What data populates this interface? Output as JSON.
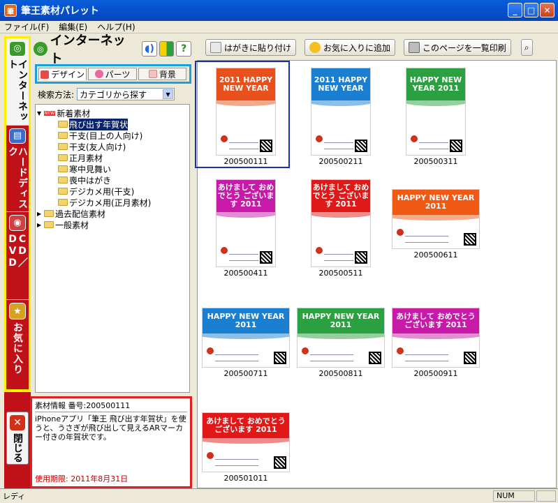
{
  "window": {
    "title": "筆王素材パレット",
    "app_icon": "筆"
  },
  "menu": [
    {
      "label": "ファイル(F)"
    },
    {
      "label": "編集(E)"
    },
    {
      "label": "ヘルプ(H)"
    }
  ],
  "side_tabs": [
    {
      "label": "インターネット",
      "icon": "globe-icon",
      "active": true
    },
    {
      "label": "ハードディスク",
      "icon": "harddisk-icon"
    },
    {
      "label": "CD／DVD",
      "icon": "disc-icon"
    },
    {
      "label": "お気に入り",
      "icon": "star-icon"
    }
  ],
  "close_tab": {
    "label": "閉じる",
    "icon": "close-icon"
  },
  "left_panel": {
    "title": "インターネット",
    "icons": [
      "speaker-icon",
      "beginner-mark-icon",
      "help-icon"
    ],
    "help_glyph": "?"
  },
  "subtabs": [
    {
      "label": "デザイン"
    },
    {
      "label": "パーツ"
    },
    {
      "label": "背景"
    }
  ],
  "search": {
    "label": "検索方法:",
    "value": "カテゴリから探す"
  },
  "tree": [
    {
      "label": "新着素材",
      "level": 0,
      "expanded": true,
      "badge": "NEW"
    },
    {
      "label": "飛び出す年賀状",
      "level": 1,
      "selected": true
    },
    {
      "label": "干支(目上の人向け)",
      "level": 1
    },
    {
      "label": "干支(友人向け)",
      "level": 1
    },
    {
      "label": "正月素材",
      "level": 1
    },
    {
      "label": "寒中見舞い",
      "level": 1
    },
    {
      "label": "喪中はがき",
      "level": 1
    },
    {
      "label": "デジカメ用(干支)",
      "level": 1
    },
    {
      "label": "デジカメ用(正月素材)",
      "level": 1
    },
    {
      "label": "過去配信素材",
      "level": 0,
      "expanded": false
    },
    {
      "label": "一般素材",
      "level": 0,
      "expanded": false
    }
  ],
  "info": {
    "header": "素材情報 番号:200500111",
    "description": "iPhoneアプリ「筆王 飛び出す年賀状」を使うと、うさぎが飛び出して見えるARマーカー付きの年賀状です。",
    "expiry": "使用期限: 2011年8月31日"
  },
  "toolbar": [
    {
      "label": "はがきに貼り付け",
      "icon": "paste-card-icon"
    },
    {
      "label": "お気に入りに追加",
      "icon": "add-favorite-icon"
    },
    {
      "label": "このページを一覧印刷",
      "icon": "print-icon"
    }
  ],
  "thumbnails": [
    {
      "id": "200500111",
      "text": "2011 HAPPY NEW YEAR",
      "color": "#e8501c",
      "orientation": "portrait",
      "selected": true
    },
    {
      "id": "200500211",
      "text": "2011 HAPPY NEW YEAR",
      "color": "#1a7fd0",
      "orientation": "portrait"
    },
    {
      "id": "200500311",
      "text": "HAPPY NEW YEAR 2011",
      "color": "#2aa040",
      "orientation": "portrait"
    },
    {
      "id": "200500411",
      "text": "あけまして おめでとう ございます 2011",
      "color": "#c81aa8",
      "orientation": "portrait"
    },
    {
      "id": "200500511",
      "text": "あけまして おめでとう ございます 2011",
      "color": "#e01818",
      "orientation": "portrait"
    },
    {
      "id": "200500611",
      "text": "HAPPY NEW YEAR 2011",
      "color": "#f05a14",
      "orientation": "landscape"
    },
    {
      "id": "200500711",
      "text": "HAPPY NEW YEAR 2011",
      "color": "#1a7fd0",
      "orientation": "landscape"
    },
    {
      "id": "200500811",
      "text": "HAPPY NEW YEAR 2011",
      "color": "#2aa040",
      "orientation": "landscape"
    },
    {
      "id": "200500911",
      "text": "あけまして おめでとう ございます 2011",
      "color": "#c81aa8",
      "orientation": "landscape"
    },
    {
      "id": "200501011",
      "text": "あけまして おめでとうございます 2011",
      "color": "#e01818",
      "orientation": "landscape"
    }
  ],
  "status": {
    "text": "レディ",
    "num": "NUM"
  },
  "colors": {
    "side_red": "#c01018",
    "highlight_yellow": "#ffee00",
    "highlight_blue": "#1aa0e0",
    "highlight_red": "#e02020",
    "selection_navy": "#0a246a"
  }
}
